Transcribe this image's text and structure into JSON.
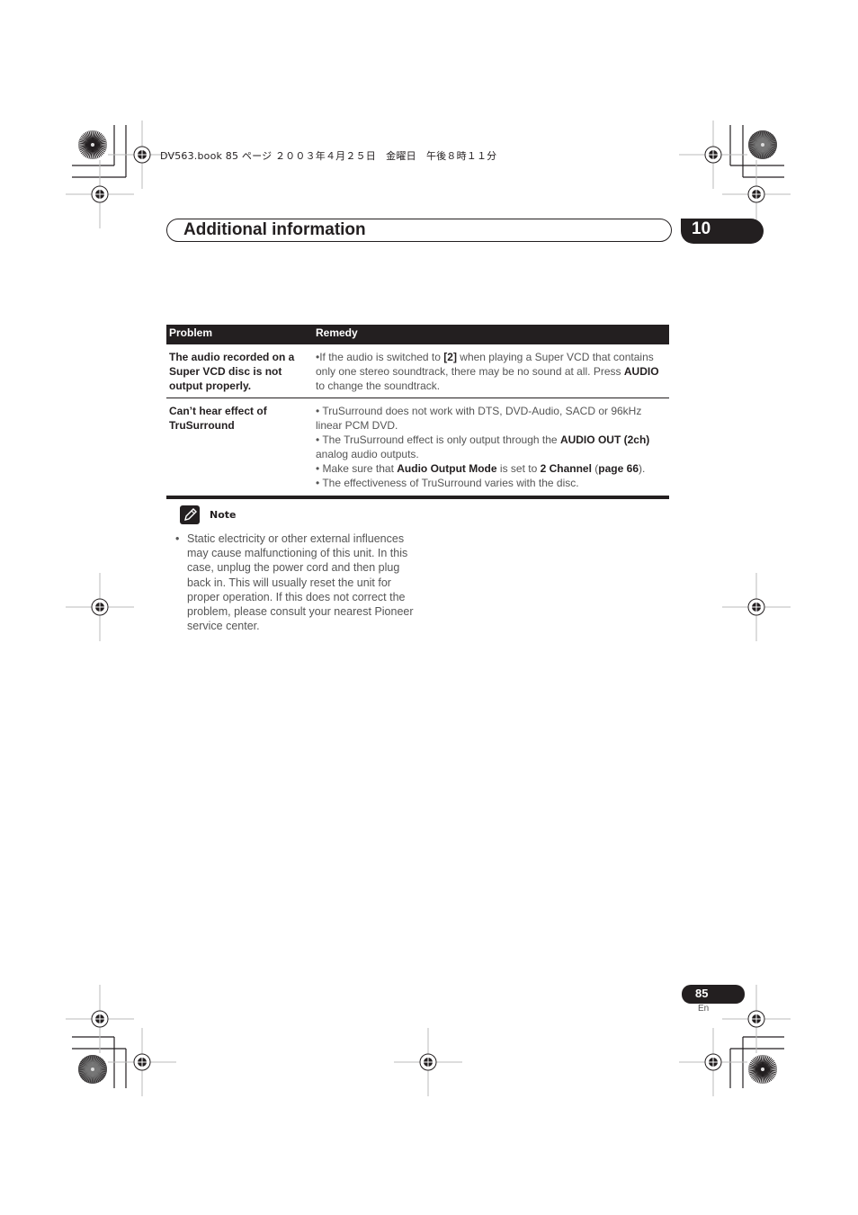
{
  "print_header": {
    "file_info": "DV563.book  85 ページ  ２００３年４月２５日　金曜日　午後８時１１分"
  },
  "section": {
    "title": "Additional information",
    "chapter_number": "10"
  },
  "table": {
    "headers": {
      "problem": "Problem",
      "remedy": "Remedy"
    },
    "rows": [
      {
        "problem": "The audio recorded on a Super VCD disc is not output properly.",
        "remedy": [
          [
            {
              "t": "•If the audio is switched to ",
              "b": false
            },
            {
              "t": "[2]",
              "b": true
            },
            {
              "t": " when playing a Super VCD that contains only one stereo soundtrack, there may be no sound at all. Press ",
              "b": false
            },
            {
              "t": "AUDIO",
              "b": true
            },
            {
              "t": " to change the soundtrack.",
              "b": false
            }
          ]
        ]
      },
      {
        "problem": "Can’t hear effect of TruSurround",
        "remedy": [
          [
            {
              "t": "• TruSurround does not work with DTS, DVD-Audio, SACD or 96kHz linear PCM DVD.",
              "b": false
            }
          ],
          [
            {
              "t": "• The TruSurround effect is only output through the ",
              "b": false
            },
            {
              "t": "AUDIO OUT (2ch)",
              "b": true
            },
            {
              "t": " analog audio outputs.",
              "b": false
            }
          ],
          [
            {
              "t": "• Make sure that ",
              "b": false
            },
            {
              "t": "Audio Output Mode",
              "b": true
            },
            {
              "t": " is set to ",
              "b": false
            },
            {
              "t": "2 Channel",
              "b": true
            },
            {
              "t": " (",
              "b": false
            },
            {
              "t": "page 66",
              "b": true
            },
            {
              "t": ").",
              "b": false
            }
          ],
          [
            {
              "t": "• The effectiveness of TruSurround varies with the disc.",
              "b": false
            }
          ]
        ]
      }
    ]
  },
  "note": {
    "label": "Note",
    "icon": "pencil-icon",
    "bullet": "•",
    "text": "Static electricity or other external influences may cause malfunctioning of this unit. In this case, unplug the power cord and then plug back in. This will usually reset the unit for proper operation. If this does not correct the problem, please consult your nearest Pioneer service center."
  },
  "footer": {
    "page_number": "85",
    "language": "En"
  },
  "colors": {
    "ink": "#231f20",
    "body_text": "#555555",
    "registration_line": "#bbbbbb"
  }
}
